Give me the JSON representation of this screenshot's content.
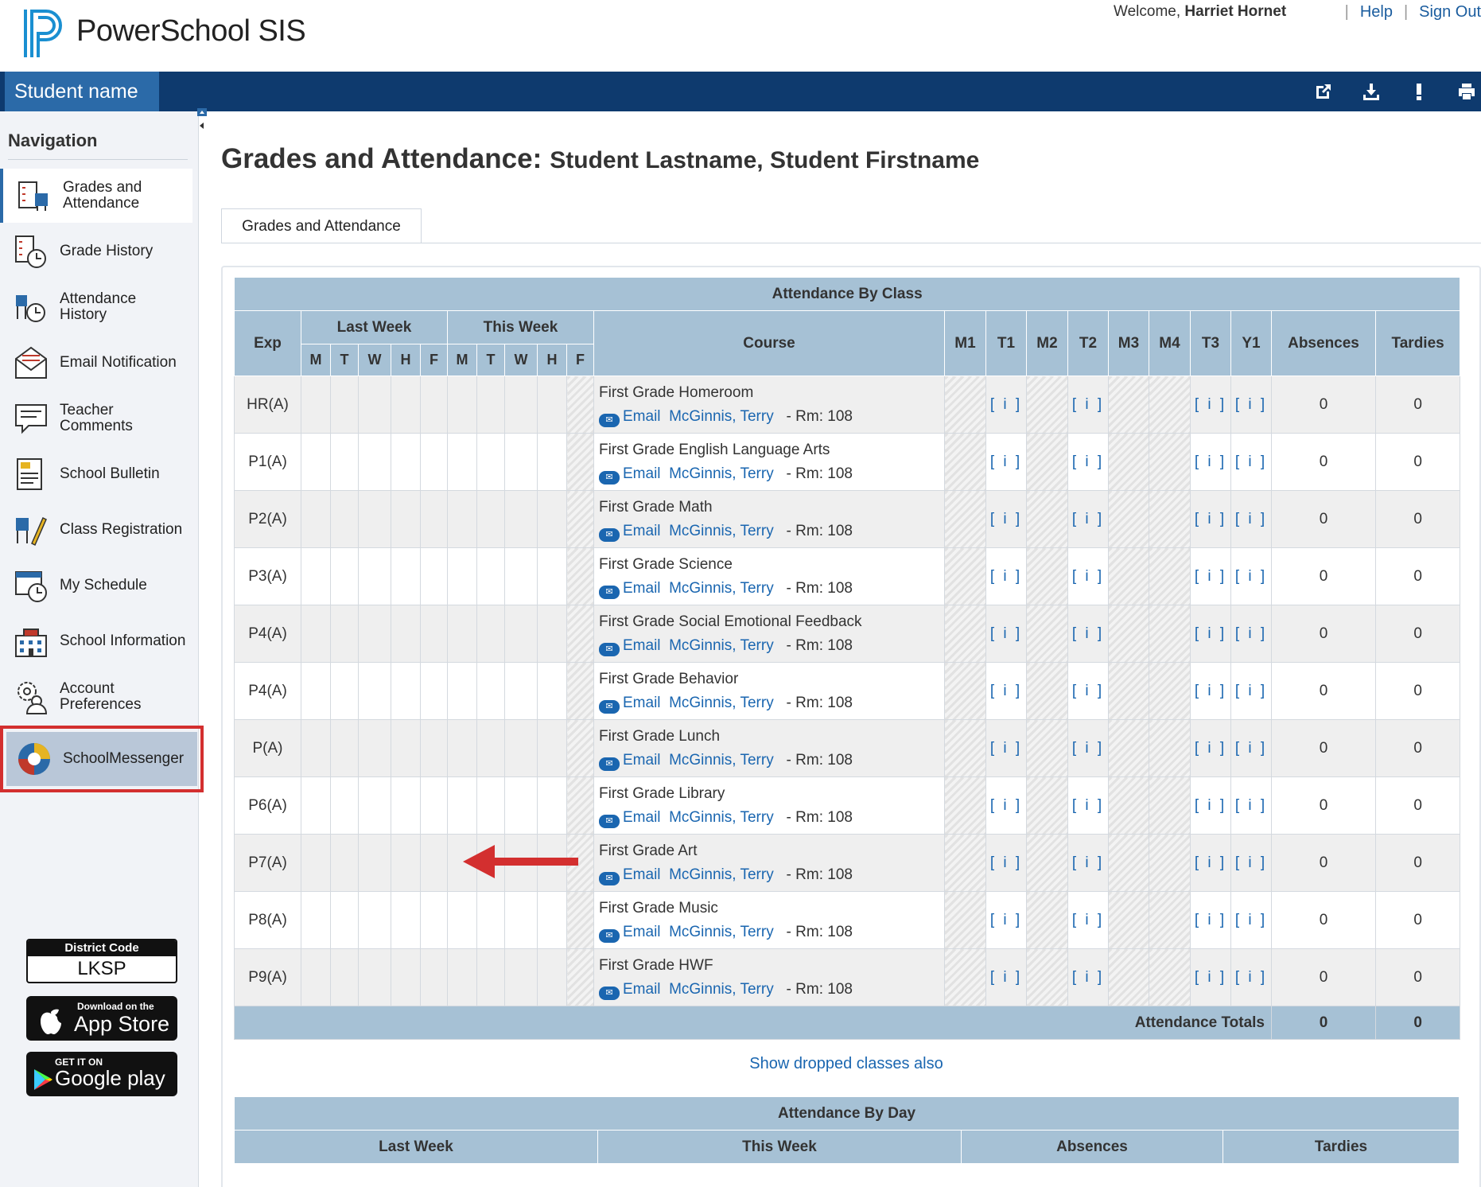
{
  "brand": {
    "name": "PowerSchool SIS"
  },
  "header": {
    "welcome_prefix": "Welcome,",
    "user": "Harriet Hornet",
    "help": "Help",
    "signout": "Sign Out"
  },
  "bar": {
    "student_tab": "Student name",
    "icons": [
      "external-link-icon",
      "download-icon",
      "alert-icon",
      "print-icon"
    ]
  },
  "nav": {
    "title": "Navigation",
    "items": [
      {
        "label": "Grades and Attendance",
        "icon": "grades-attendance-icon"
      },
      {
        "label": "Grade History",
        "icon": "grade-history-icon"
      },
      {
        "label": "Attendance History",
        "icon": "attendance-history-icon"
      },
      {
        "label": "Email Notification",
        "icon": "email-notification-icon"
      },
      {
        "label": "Teacher Comments",
        "icon": "teacher-comments-icon"
      },
      {
        "label": "School Bulletin",
        "icon": "school-bulletin-icon"
      },
      {
        "label": "Class Registration",
        "icon": "class-registration-icon"
      },
      {
        "label": "My Schedule",
        "icon": "my-schedule-icon"
      },
      {
        "label": "School Information",
        "icon": "school-information-icon"
      },
      {
        "label": "Account Preferences",
        "icon": "account-preferences-icon"
      },
      {
        "label": "SchoolMessenger",
        "icon": "schoolmessenger-icon"
      }
    ],
    "district_label": "District Code",
    "district_code": "LKSP",
    "appstore_small": "Download on the",
    "appstore_big": "App Store",
    "play_small": "GET IT ON",
    "play_big": "Google play"
  },
  "page": {
    "title": "Grades and Attendance:",
    "student": "Student Lastname, Student Firstname",
    "tab": "Grades and Attendance"
  },
  "attendance": {
    "caption": "Attendance By Class",
    "headers": {
      "exp": "Exp",
      "last_week": "Last Week",
      "this_week": "This Week",
      "course": "Course",
      "days": [
        "M",
        "T",
        "W",
        "H",
        "F"
      ],
      "terms": [
        "M1",
        "T1",
        "M2",
        "T2",
        "M3",
        "M4",
        "T3",
        "Y1"
      ],
      "absences": "Absences",
      "tardies": "Tardies"
    },
    "email_label": "Email",
    "info_label": "[ i ]",
    "rows": [
      {
        "exp": "HR(A)",
        "course": "First Grade Homeroom",
        "teacher": "McGinnis, Terry",
        "room": "- Rm: 108",
        "absences": "0",
        "tardies": "0"
      },
      {
        "exp": "P1(A)",
        "course": "First Grade English Language Arts",
        "teacher": "McGinnis, Terry",
        "room": "- Rm: 108",
        "absences": "0",
        "tardies": "0"
      },
      {
        "exp": "P2(A)",
        "course": "First Grade Math",
        "teacher": "McGinnis, Terry",
        "room": "- Rm: 108",
        "absences": "0",
        "tardies": "0"
      },
      {
        "exp": "P3(A)",
        "course": "First Grade Science",
        "teacher": "McGinnis, Terry",
        "room": "- Rm: 108",
        "absences": "0",
        "tardies": "0"
      },
      {
        "exp": "P4(A)",
        "course": "First Grade Social Emotional Feedback",
        "teacher": "McGinnis, Terry",
        "room": "- Rm: 108",
        "absences": "0",
        "tardies": "0"
      },
      {
        "exp": "P4(A)",
        "course": "First Grade Behavior",
        "teacher": "McGinnis, Terry",
        "room": "- Rm: 108",
        "absences": "0",
        "tardies": "0"
      },
      {
        "exp": "P(A)",
        "course": "First Grade Lunch",
        "teacher": "McGinnis, Terry",
        "room": "- Rm: 108",
        "absences": "0",
        "tardies": "0"
      },
      {
        "exp": "P6(A)",
        "course": "First Grade Library",
        "teacher": "McGinnis, Terry",
        "room": "- Rm: 108",
        "absences": "0",
        "tardies": "0"
      },
      {
        "exp": "P7(A)",
        "course": "First Grade Art",
        "teacher": "McGinnis, Terry",
        "room": "- Rm: 108",
        "absences": "0",
        "tardies": "0"
      },
      {
        "exp": "P8(A)",
        "course": "First Grade Music",
        "teacher": "McGinnis, Terry",
        "room": "- Rm: 108",
        "absences": "0",
        "tardies": "0"
      },
      {
        "exp": "P9(A)",
        "course": "First Grade HWF",
        "teacher": "McGinnis, Terry",
        "room": "- Rm: 108",
        "absences": "0",
        "tardies": "0"
      }
    ],
    "totals_label": "Attendance Totals",
    "total_absences": "0",
    "total_tardies": "0",
    "dropped_link": "Show dropped classes also"
  },
  "by_day": {
    "caption": "Attendance By Day",
    "headers": [
      "Last Week",
      "This Week",
      "Absences",
      "Tardies"
    ]
  },
  "colors": {
    "navy": "#0e3a6e",
    "tab_blue": "#2b6aa8",
    "header_blue": "#a6c1d5",
    "link": "#1a66b0",
    "highlight_red": "#d32f2f"
  }
}
